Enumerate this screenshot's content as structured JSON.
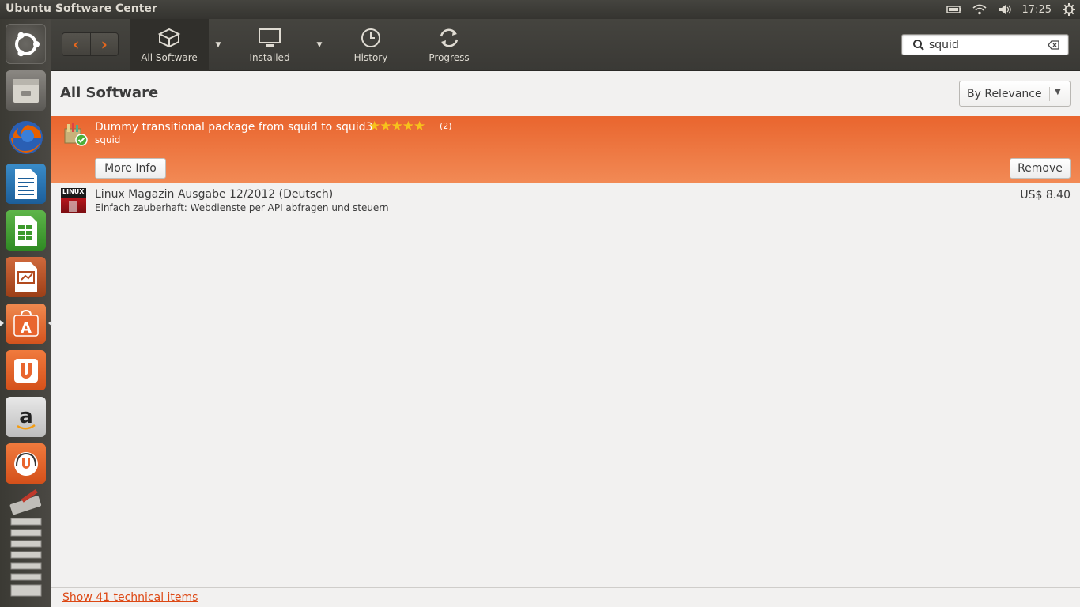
{
  "window": {
    "title": "Ubuntu Software Center"
  },
  "panel": {
    "clock": "17:25"
  },
  "launcher": {
    "items": [
      {
        "name": "dash-icon"
      },
      {
        "name": "files-icon"
      },
      {
        "name": "firefox-icon"
      },
      {
        "name": "writer-icon"
      },
      {
        "name": "calc-icon"
      },
      {
        "name": "impress-icon"
      },
      {
        "name": "software-center-icon"
      },
      {
        "name": "ubuntu-one-icon"
      },
      {
        "name": "amazon-icon"
      },
      {
        "name": "ubuntu-one-music-icon"
      },
      {
        "name": "system-settings-icon"
      },
      {
        "name": "workspaces-icon"
      }
    ]
  },
  "toolbar": {
    "all_software": "All Software",
    "installed": "Installed",
    "history": "History",
    "progress": "Progress"
  },
  "search": {
    "value": "squid"
  },
  "content": {
    "heading": "All Software",
    "sort": "By Relevance"
  },
  "results": [
    {
      "name": "Dummy transitional package from squid to squid3",
      "package": "squid",
      "rating_stars": 5,
      "rating_count": "(2)",
      "more_info": "More Info",
      "action": "Remove"
    },
    {
      "name": "Linux Magazin Ausgabe 12/2012 (Deutsch)",
      "summary": "Einfach zauberhaft: Webdienste per API abfragen und steuern",
      "price": "US$ 8.40",
      "icon_text": "LINUX"
    }
  ],
  "footer": {
    "technical_link": "Show 41 technical items"
  },
  "colors": {
    "accent": "#e9652e",
    "panel": "#3c3b37",
    "link": "#dd4814"
  }
}
